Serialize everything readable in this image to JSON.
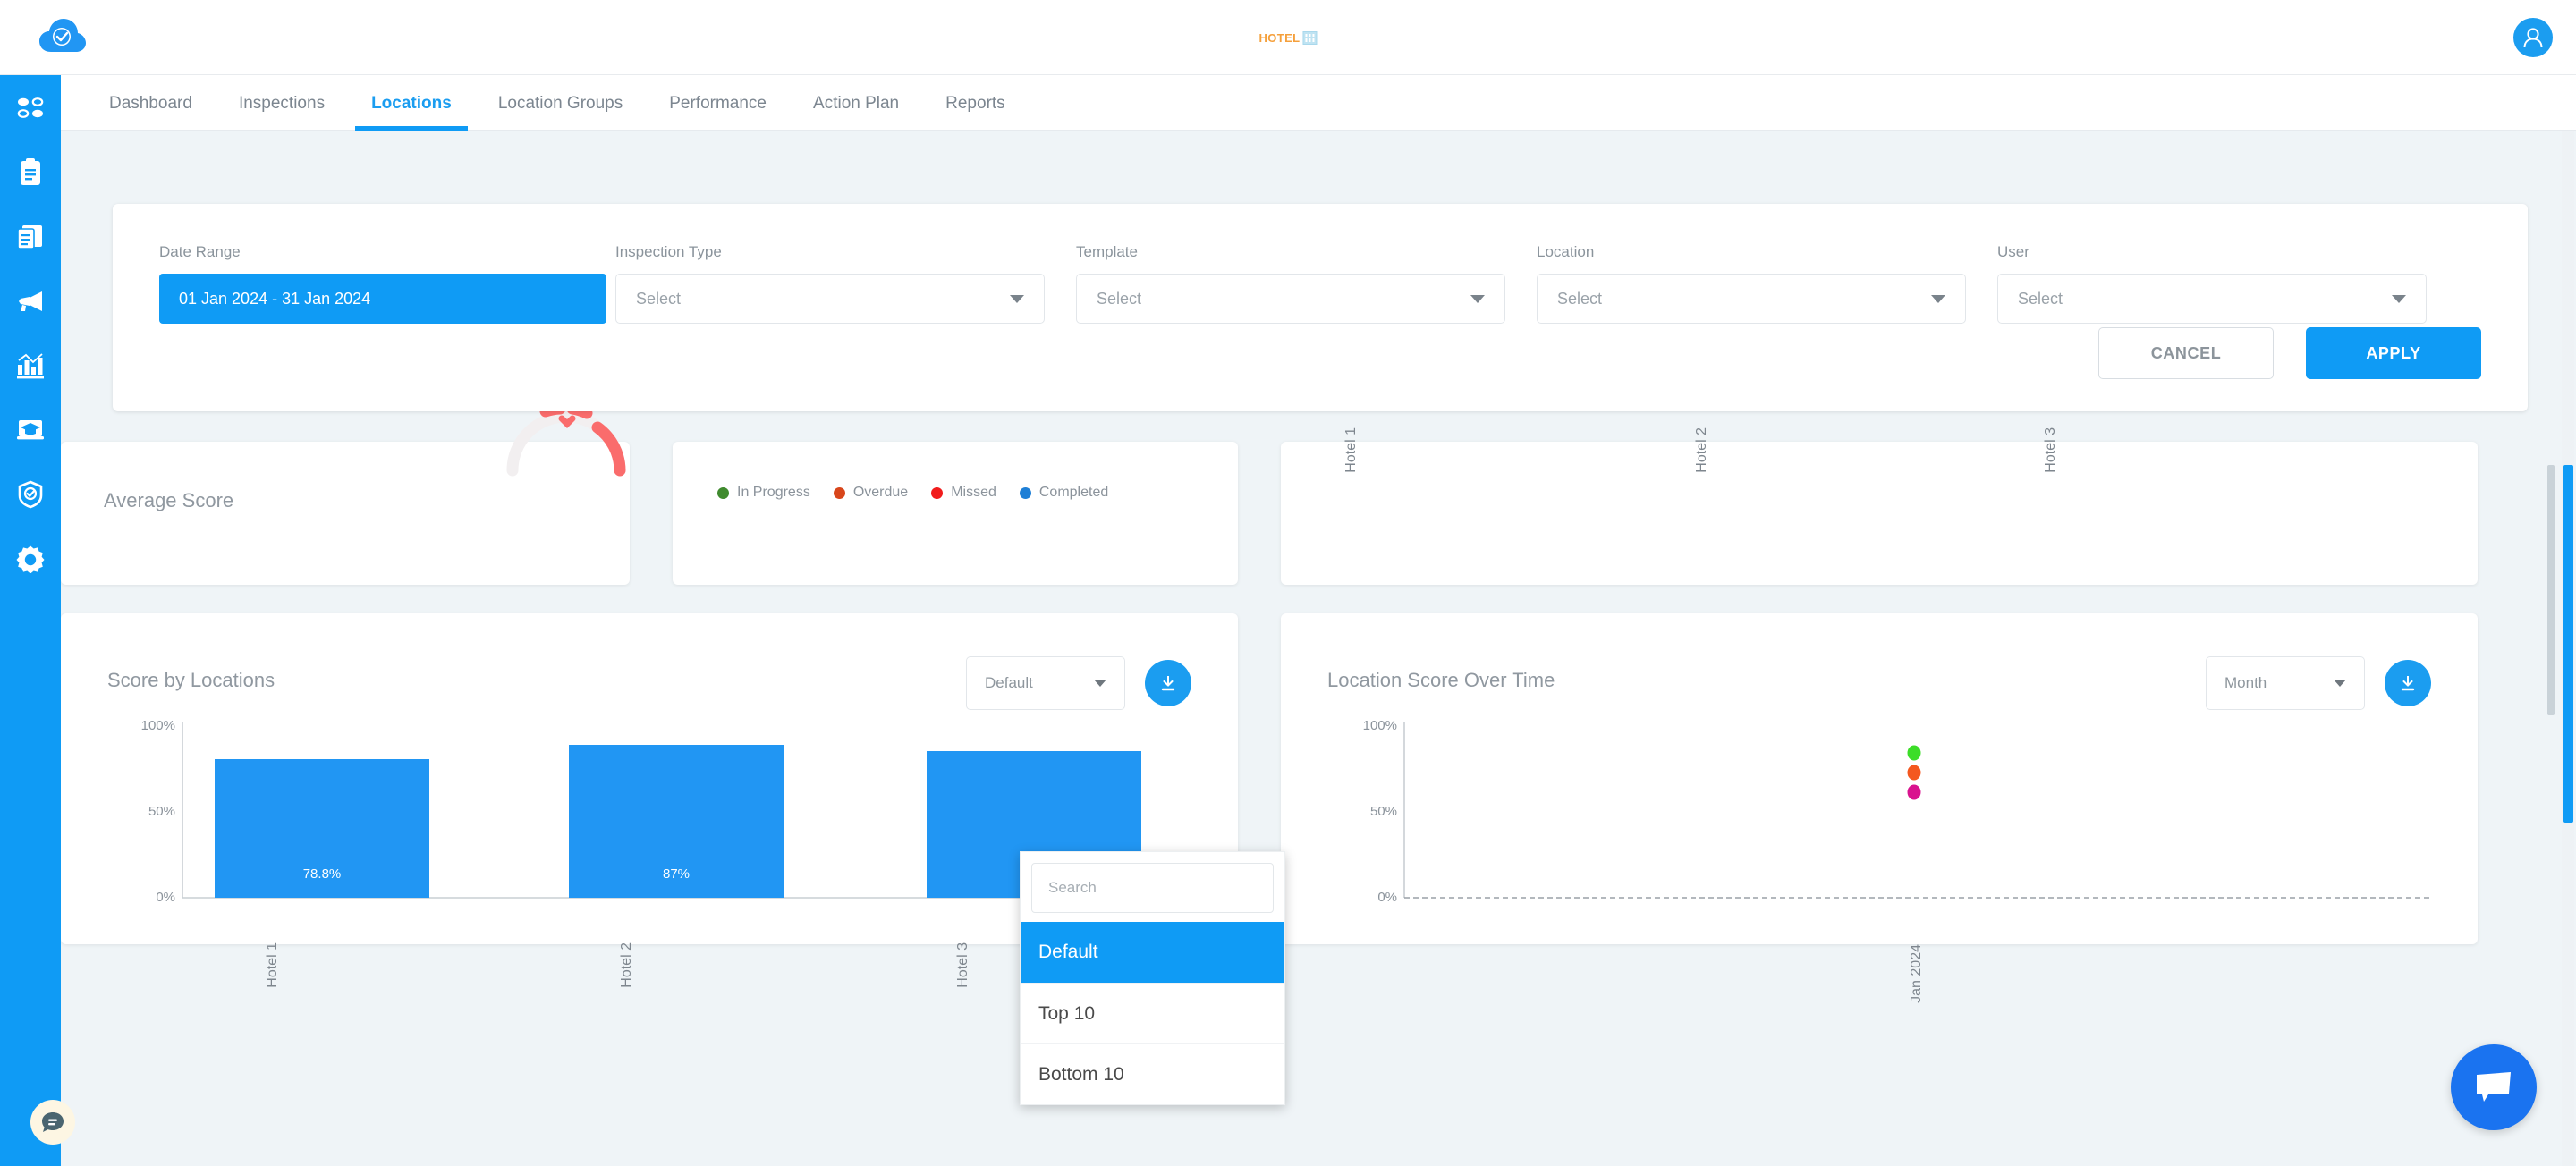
{
  "brand": {
    "text": "HOTEL",
    "icon": "building-icon",
    "accent": "#f5a03c"
  },
  "topbar": {
    "logo": "cloud-check-logo",
    "avatar": "user-avatar"
  },
  "sidebar": {
    "items": [
      {
        "name": "dashboard-grid-icon"
      },
      {
        "name": "clipboard-icon"
      },
      {
        "name": "documents-icon"
      },
      {
        "name": "megaphone-icon"
      },
      {
        "name": "analytics-icon"
      },
      {
        "name": "training-icon"
      },
      {
        "name": "shield-check-icon"
      },
      {
        "name": "gear-icon"
      }
    ]
  },
  "nav": {
    "tabs": [
      {
        "label": "Dashboard",
        "active": false
      },
      {
        "label": "Inspections",
        "active": false
      },
      {
        "label": "Locations",
        "active": true
      },
      {
        "label": "Location Groups",
        "active": false
      },
      {
        "label": "Performance",
        "active": false
      },
      {
        "label": "Action Plan",
        "active": false
      },
      {
        "label": "Reports",
        "active": false
      }
    ]
  },
  "filters": {
    "date_range": {
      "label": "Date Range",
      "value": "01 Jan 2024 - 31 Jan 2024"
    },
    "inspection_type": {
      "label": "Inspection Type",
      "placeholder": "Select"
    },
    "template": {
      "label": "Template",
      "placeholder": "Select"
    },
    "location": {
      "label": "Location",
      "placeholder": "Select"
    },
    "user": {
      "label": "User",
      "placeholder": "Select"
    },
    "cancel_label": "CANCEL",
    "apply_label": "APPLY"
  },
  "cards": {
    "average_score": {
      "title": "Average Score"
    },
    "status_legend": [
      {
        "label": "In Progress",
        "color": "#3f8a2e"
      },
      {
        "label": "Overdue",
        "color": "#d8461b"
      },
      {
        "label": "Missed",
        "color": "#f11c1c"
      },
      {
        "label": "Completed",
        "color": "#1e7fd6"
      }
    ],
    "top_right_labels": [
      "Hotel 1",
      "Hotel 2",
      "Hotel 3"
    ],
    "score_by_locations": {
      "title": "Score by Locations",
      "select_value": "Default",
      "download": "download-icon"
    },
    "location_score_over_time": {
      "title": "Location Score Over Time",
      "select_value": "Month",
      "download": "download-icon"
    }
  },
  "dropdown": {
    "search_placeholder": "Search",
    "options": [
      {
        "label": "Default",
        "selected": true
      },
      {
        "label": "Top 10",
        "selected": false
      },
      {
        "label": "Bottom 10",
        "selected": false
      }
    ]
  },
  "chart_data": [
    {
      "type": "bar",
      "title": "Score by Locations",
      "categories": [
        "Hotel 1",
        "Hotel 2",
        "Hotel 3"
      ],
      "values": [
        78.8,
        87,
        84
      ],
      "data_labels": [
        "78.8%",
        "87%",
        ""
      ],
      "ylabel": "",
      "xlabel": "",
      "ylim": [
        0,
        100
      ],
      "ytick_labels": [
        "0%",
        "50%",
        "100%"
      ],
      "yticks": [
        0,
        50,
        100
      ],
      "grid": false,
      "bar_color": "#2196f3"
    },
    {
      "type": "scatter",
      "title": "Location Score Over Time",
      "x": [
        "Jan 2024"
      ],
      "xtick_labels": [
        "Jan 2024"
      ],
      "ylim": [
        0,
        100
      ],
      "ytick_labels": [
        "0%",
        "50%",
        "100%"
      ],
      "yticks": [
        0,
        50,
        100
      ],
      "grid": false,
      "series": [
        {
          "name": "Hotel 2",
          "color": "#3cdd28",
          "values": [
            87
          ]
        },
        {
          "name": "Hotel 1",
          "color": "#f4581f",
          "values": [
            78.8
          ]
        },
        {
          "name": "Hotel 3",
          "color": "#d9138f",
          "values": [
            70
          ]
        }
      ]
    }
  ],
  "chat": {
    "left_icon": "chat-bubble-icon",
    "right_icon": "chat-widget-icon"
  }
}
